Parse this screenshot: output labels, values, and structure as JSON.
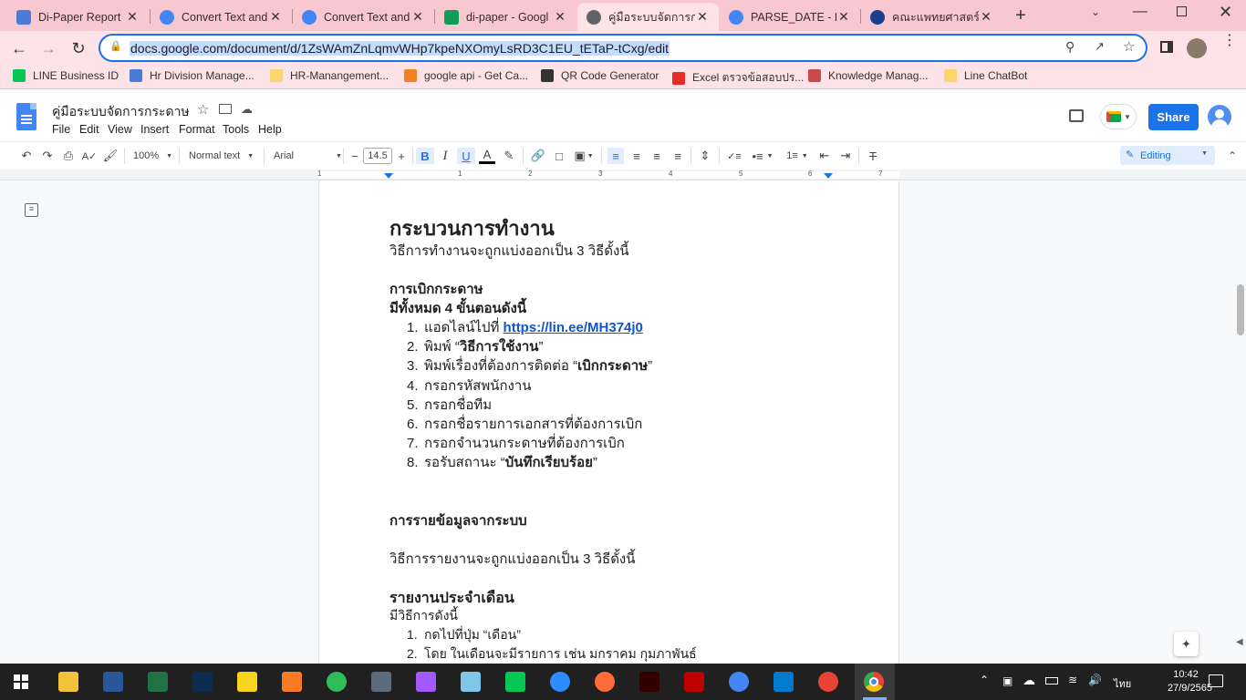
{
  "browser": {
    "tabs": [
      {
        "title": "Di-Paper Report",
        "icon": "rainbow-icon",
        "color": "#4a7bd6"
      },
      {
        "title": "Convert Text and",
        "icon": "google-icon",
        "color": "#4285f4"
      },
      {
        "title": "Convert Text and",
        "icon": "google-icon",
        "color": "#4285f4"
      },
      {
        "title": "di-paper - Googl",
        "icon": "sheets-icon",
        "color": "#0f9d58"
      },
      {
        "title": "คู่มือระบบจัดการกร",
        "icon": "globe-icon",
        "color": "#5f6368"
      },
      {
        "title": "PARSE_DATE - Da",
        "icon": "google-icon",
        "color": "#4285f4"
      },
      {
        "title": "คณะแพทยศาสตร์โร",
        "icon": "emblem-icon",
        "color": "#1a3f8f"
      }
    ],
    "active_tab": 4,
    "url": "docs.google.com/document/d/1ZsWAmZnLqmvWHp7kpeNXOmyLsRD3C1EU_tETaP-tCxg/edit",
    "bookmarks": [
      {
        "label": "LINE Business ID",
        "color": "#06c755"
      },
      {
        "label": "Hr Division Manage...",
        "color": "#4a7bd6"
      },
      {
        "label": "HR-Manangement...",
        "color": "#f9d56e"
      },
      {
        "label": "google api - Get Ca...",
        "color": "#f48024"
      },
      {
        "label": "QR Code Generator",
        "color": "#333333"
      },
      {
        "label": "Excel ตรวจข้อสอบปร...",
        "color": "#e52d27"
      },
      {
        "label": "Knowledge Manag...",
        "color": "#c94a4a"
      },
      {
        "label": "Line ChatBot",
        "color": "#f9d56e"
      }
    ]
  },
  "docs": {
    "title": "คู่มือระบบจัดการกระดาษ",
    "menus": [
      "File",
      "Edit",
      "View",
      "Insert",
      "Format",
      "Tools",
      "Help"
    ],
    "share_label": "Share",
    "zoom": "100%",
    "style": "Normal text",
    "font": "Arial",
    "font_size": "14.5",
    "mode": "Editing",
    "ruler": [
      "1",
      "1",
      "2",
      "3",
      "4",
      "5",
      "6",
      "7"
    ]
  },
  "content": {
    "heading": "กระบวนการทำงาน",
    "intro": "วิธีการทำงานจะถูกแบ่งออกเป็น 3 วิธีดั้งนี้",
    "sec1_title": "การเบิกกระดาษ",
    "sec1_sub": "มีทั้งหมด 4 ขั้นตอนดังนี้",
    "steps": [
      {
        "n": "1.",
        "pre": "แอดไลน์ไปที่ ",
        "bold": "",
        "link": "https://lin.ee/MH374j0",
        "post": ""
      },
      {
        "n": "2.",
        "pre": "พิมพ์ “",
        "bold": "วิธีการใช้งาน",
        "link": "",
        "post": "”"
      },
      {
        "n": "3.",
        "pre": "พิมพ์เรื่องที่ต้องการติดต่อ “",
        "bold": "เบิกกระดาษ",
        "link": "",
        "post": "”"
      },
      {
        "n": "4.",
        "pre": "กรอกรหัสพนักงาน",
        "bold": "",
        "link": "",
        "post": ""
      },
      {
        "n": "5.",
        "pre": "กรอกชื่อทีม",
        "bold": "",
        "link": "",
        "post": ""
      },
      {
        "n": "6.",
        "pre": "กรอกชื่อรายการเอกสารที่ต้องการเบิก",
        "bold": "",
        "link": "",
        "post": ""
      },
      {
        "n": "7.",
        "pre": "กรอกจำนวนกระดาษที่ต้องการเบิก",
        "bold": "",
        "link": "",
        "post": ""
      },
      {
        "n": "8.",
        "pre": "รอรับสถานะ “",
        "bold": "บันทึกเรียบร้อย",
        "link": "",
        "post": "”"
      }
    ],
    "sec2_title": "การรายข้อมูลจากระบบ",
    "sec2_intro": "วิธีการรายงานจะถูกแบ่งออกเป็น 3 วิธีดั้งนี้",
    "sec3_title": "รายงานประจำเดือน",
    "sec3_sub": "มีวิธีการดังนี้",
    "steps2": [
      {
        "n": "1.",
        "text": "กดไปที่ปุ่ม “เดือน”"
      },
      {
        "n": "2.",
        "text": "โดย ในเดือนจะมีรายการ เช่น มกราคม กุมภาพันธ์"
      }
    ]
  },
  "taskbar": {
    "time": "10:42",
    "date": "27/9/2565",
    "lang": "ไทย"
  }
}
